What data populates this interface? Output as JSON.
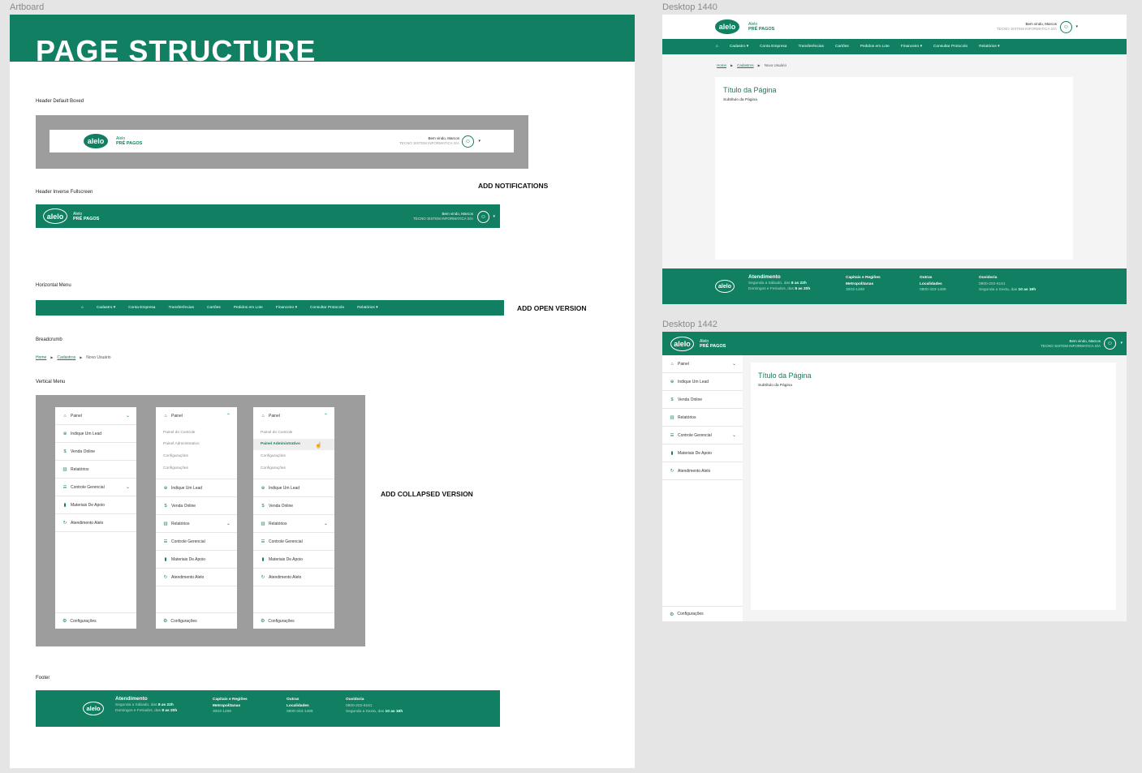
{
  "frames": {
    "artboard": "Artboard",
    "desktop1": "Desktop 1440",
    "desktop2": "Desktop 1442"
  },
  "colors": {
    "brand_green": "#117f62",
    "gray_backdrop": "#9d9d9d",
    "canvas": "#e5e5e5"
  },
  "page_structure": {
    "title": "PAGE STRUCTURE"
  },
  "sections": {
    "header_boxed": "Header Default Boxed",
    "header_inverse": "Header Inverse Fullscreen",
    "horizontal_menu": "Horizontal Menu",
    "breadcrumb": "Breadcrumb",
    "vertical_menu": "Vertical Menu",
    "footer": "Footer"
  },
  "notes": {
    "notifications": "ADD NOTIFICATIONS",
    "open_version": "ADD OPEN VERSION",
    "collapsed_version": "ADD COLLAPSED VERSION"
  },
  "header": {
    "logo": "alelo",
    "brand_top": "Alelo",
    "brand_bottom": "PRÉ PAGOS",
    "welcome": "Bem vindo, Marcos",
    "company": "TECNO SISTEM INFORMATICA S/A"
  },
  "menu": {
    "items": [
      "Cadastro",
      "Conta Empresa",
      "Transferências",
      "Cartões",
      "Pedidos em Lote",
      "Financeiro",
      "Consultar Protocolo",
      "Relatórios"
    ]
  },
  "breadcrumb": {
    "home": "Home",
    "cadastros": "Cadastros",
    "current": "Novo Usuário"
  },
  "vertical_menu": {
    "painel": "Painel",
    "indique": "Indique Um Lead",
    "venda": "Venda Online",
    "relatorios": "Relatórios",
    "controle": "Controle Gerencial",
    "materiais": "Materiais De Apoio",
    "atendimento": "Atendimento Alelo",
    "configuracoes": "Configurações",
    "sub": [
      "Painel de Controle",
      "Painel Administrativo",
      "Configurações",
      "Configurações"
    ]
  },
  "footer": {
    "atendimento_title": "Atendimento",
    "atendimento_line1_a": "Segunda a Sábado, das ",
    "atendimento_line1_b": "8 as 22h",
    "atendimento_line2_a": "Domingos e Feriados, das ",
    "atendimento_line2_b": "8 as 20h",
    "capitais_title_1": "Capitais e Regiões",
    "capitais_title_2": "Metropolitanas",
    "capitais_phone": "3003-1469",
    "outras_title_1": "Outras",
    "outras_title_2": "Localidades",
    "outras_phone": "0800-333-1469",
    "ouvidoria_title": "Ouvidoria",
    "ouvidoria_phone": "0800-202-6161",
    "ouvidoria_hours_a": "Segunda a Sexta, das ",
    "ouvidoria_hours_b": "10 as 16h"
  },
  "page": {
    "title": "Título da Página",
    "subtitle": "Subtítulo da Página"
  }
}
